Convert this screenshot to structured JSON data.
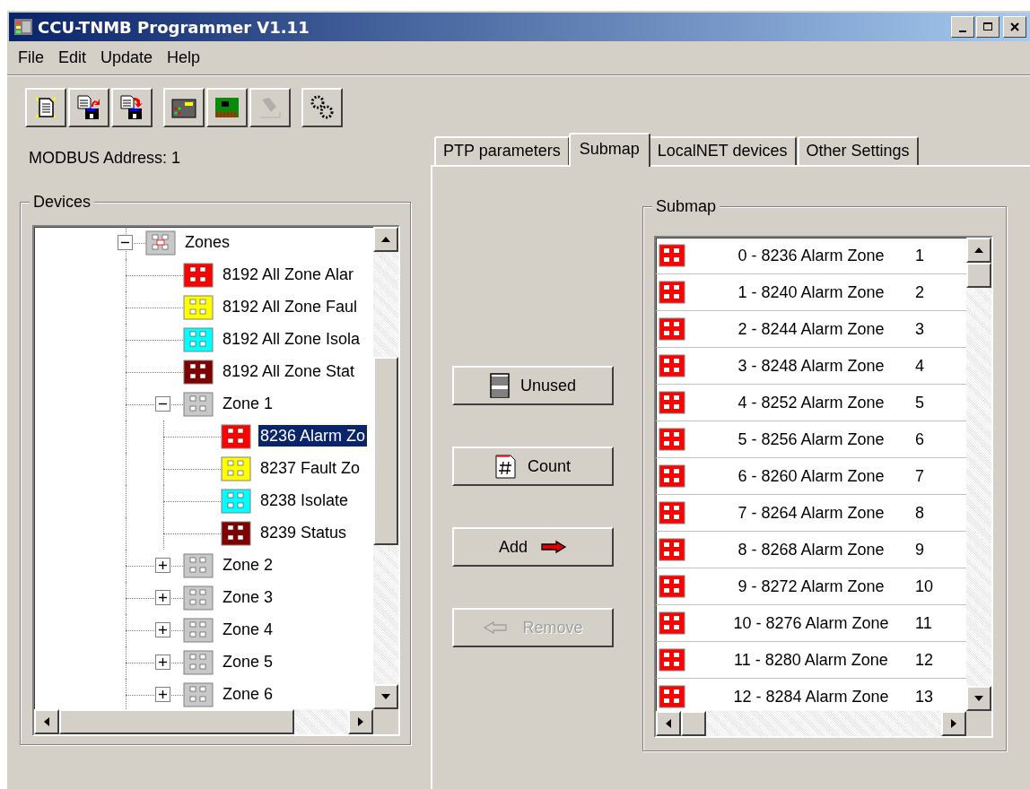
{
  "window": {
    "title": "CCU-TNMB Programmer V1.11"
  },
  "menu": [
    {
      "label": "File"
    },
    {
      "label": "Edit"
    },
    {
      "label": "Update"
    },
    {
      "label": "Help"
    }
  ],
  "toolbar": [
    {
      "kind": "new",
      "disabled": false
    },
    {
      "kind": "upload",
      "disabled": false
    },
    {
      "kind": "download",
      "disabled": false
    },
    {
      "kind": "panel",
      "disabled": false
    },
    {
      "kind": "board",
      "disabled": false
    },
    {
      "kind": "tool",
      "disabled": true
    },
    {
      "kind": "gears",
      "disabled": false
    }
  ],
  "modbus_address": "MODBUS Address: 1",
  "devices": {
    "label": "Devices",
    "tree": [
      {
        "label": "Zones",
        "kind": "root",
        "expanded": true,
        "selected": false,
        "children": [
          {
            "label": "8192 All Zone Alar",
            "color": "#ff0000",
            "selected": false
          },
          {
            "label": "8192 All Zone Faul",
            "color": "#ffff00",
            "selected": false
          },
          {
            "label": "8192 All Zone Isola",
            "color": "#00ffff",
            "selected": false
          },
          {
            "label": "8192 All Zone Stat",
            "color": "#800000",
            "selected": false
          },
          {
            "label": "Zone 1",
            "expanded": true,
            "selected": false,
            "children": [
              {
                "label": "8236 Alarm Zo",
                "color": "#ff0000",
                "selected": true
              },
              {
                "label": "8237 Fault Zo",
                "color": "#ffff00",
                "selected": false
              },
              {
                "label": "8238 Isolate",
                "color": "#00ffff",
                "selected": false
              },
              {
                "label": "8239 Status",
                "color": "#800000",
                "selected": false
              }
            ]
          },
          {
            "label": "Zone 2",
            "expanded": false,
            "selected": false
          },
          {
            "label": "Zone 3",
            "expanded": false,
            "selected": false
          },
          {
            "label": "Zone 4",
            "expanded": false,
            "selected": false
          },
          {
            "label": "Zone 5",
            "expanded": false,
            "selected": false
          },
          {
            "label": "Zone 6",
            "expanded": false,
            "selected": false
          }
        ]
      }
    ]
  },
  "tabs": [
    {
      "label": "PTP parameters",
      "selected": false
    },
    {
      "label": "Submap",
      "selected": true
    },
    {
      "label": "LocalNET devices",
      "selected": false
    },
    {
      "label": "Other Settings",
      "selected": false
    }
  ],
  "actions": [
    {
      "label": "Unused",
      "kind": "unused",
      "disabled": false
    },
    {
      "label": "Count",
      "kind": "count",
      "disabled": false
    },
    {
      "label": "Add",
      "kind": "add",
      "disabled": false
    },
    {
      "label": "Remove",
      "kind": "remove",
      "disabled": true
    }
  ],
  "submap": {
    "label": "Submap",
    "items": [
      {
        "text": "0 - 8236 Alarm Zone",
        "zone": "1",
        "color": "#ff0000",
        "selected": false
      },
      {
        "text": "1 - 8240 Alarm Zone",
        "zone": "2",
        "color": "#ff0000",
        "selected": false
      },
      {
        "text": "2 - 8244 Alarm Zone",
        "zone": "3",
        "color": "#ff0000",
        "selected": false
      },
      {
        "text": "3 - 8248 Alarm Zone",
        "zone": "4",
        "color": "#ff0000",
        "selected": false
      },
      {
        "text": "4 - 8252 Alarm Zone",
        "zone": "5",
        "color": "#ff0000",
        "selected": false
      },
      {
        "text": "5 - 8256 Alarm Zone",
        "zone": "6",
        "color": "#ff0000",
        "selected": false
      },
      {
        "text": "6 - 8260 Alarm Zone",
        "zone": "7",
        "color": "#ff0000",
        "selected": false
      },
      {
        "text": "7 - 8264 Alarm Zone",
        "zone": "8",
        "color": "#ff0000",
        "selected": false
      },
      {
        "text": "8 - 8268 Alarm Zone",
        "zone": "9",
        "color": "#ff0000",
        "selected": false
      },
      {
        "text": "9 - 8272 Alarm Zone",
        "zone": "10",
        "color": "#ff0000",
        "selected": false
      },
      {
        "text": "10 - 8276 Alarm Zone",
        "zone": "11",
        "color": "#ff0000",
        "selected": false
      },
      {
        "text": "11 - 8280 Alarm Zone",
        "zone": "12",
        "color": "#ff0000",
        "selected": false
      },
      {
        "text": "12 - 8284 Alarm Zone",
        "zone": "13",
        "color": "#ff0000",
        "selected": false
      }
    ]
  }
}
